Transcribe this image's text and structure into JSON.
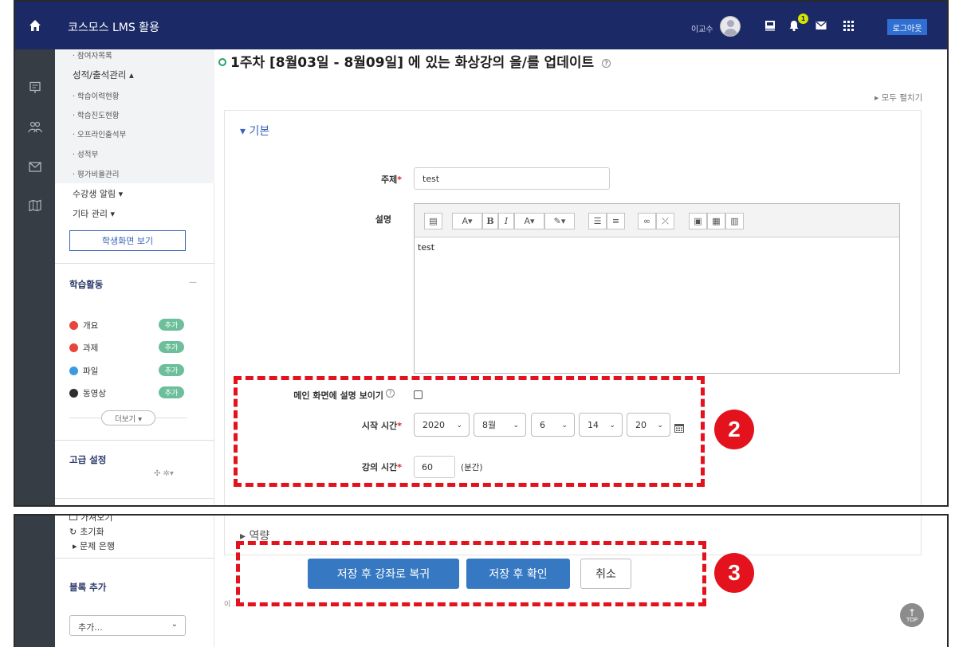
{
  "header": {
    "app_title": "코스모스 LMS 활용",
    "user_name": "이교수",
    "notification_count": "1",
    "logout_label": "로그아웃"
  },
  "sidebar": {
    "sub_top": "· 참여자목록",
    "grades_attendance": "성적/출석관리 ▴",
    "grades_items": [
      "· 학습이력현황",
      "· 학습진도현황",
      "· 오프라인출석부",
      "· 성적부",
      "· 평가비율관리"
    ],
    "student_alerts": "수강생 알림 ▾",
    "other_manage": "기타 관리 ▾",
    "student_view_button": "학생화면 보기",
    "activities_title": "학습활동",
    "activities_collapse": "—",
    "activities": [
      {
        "label": "개요",
        "add": "추가",
        "color": "#e8453c"
      },
      {
        "label": "과제",
        "add": "추가",
        "color": "#e8453c"
      },
      {
        "label": "파일",
        "add": "추가",
        "color": "#3b9be0"
      },
      {
        "label": "동영상",
        "add": "추가",
        "color": "#2d2d2d"
      }
    ],
    "more_button": "더보기 ▾",
    "advanced_title": "고급 설정",
    "bottom_items": [
      "가져오기",
      "초기화",
      "▸ 문제 은행"
    ],
    "add_block_title": "블록 추가",
    "add_block_select": "추가..."
  },
  "main": {
    "page_title": "1주차 [8월03일 - 8월09일] 에 있는 화상강의 을/를 업데이트",
    "expand_all": "▸ 모두 펼치기",
    "section_basic": "▾ 기본",
    "section_capacity": "▸ 역량",
    "fields": {
      "subject_label": "주제",
      "subject_value": "test",
      "description_label": "설명",
      "description_value": "test",
      "show_desc_label": "메인 화면에 설명 보이기",
      "start_time_label": "시작 시간",
      "start_year": "2020",
      "start_month": "8월",
      "start_day": "6",
      "start_hour": "14",
      "start_minute": "20",
      "duration_label": "강의 시간",
      "duration_value": "60",
      "duration_unit": "(분간)"
    },
    "buttons": {
      "save_return": "저장 후 강좌로 복귀",
      "save_view": "저장 후 확인",
      "cancel": "취소"
    },
    "footer_text": "이 ...",
    "callouts": [
      "2",
      "3"
    ],
    "top_button": "TOP"
  }
}
